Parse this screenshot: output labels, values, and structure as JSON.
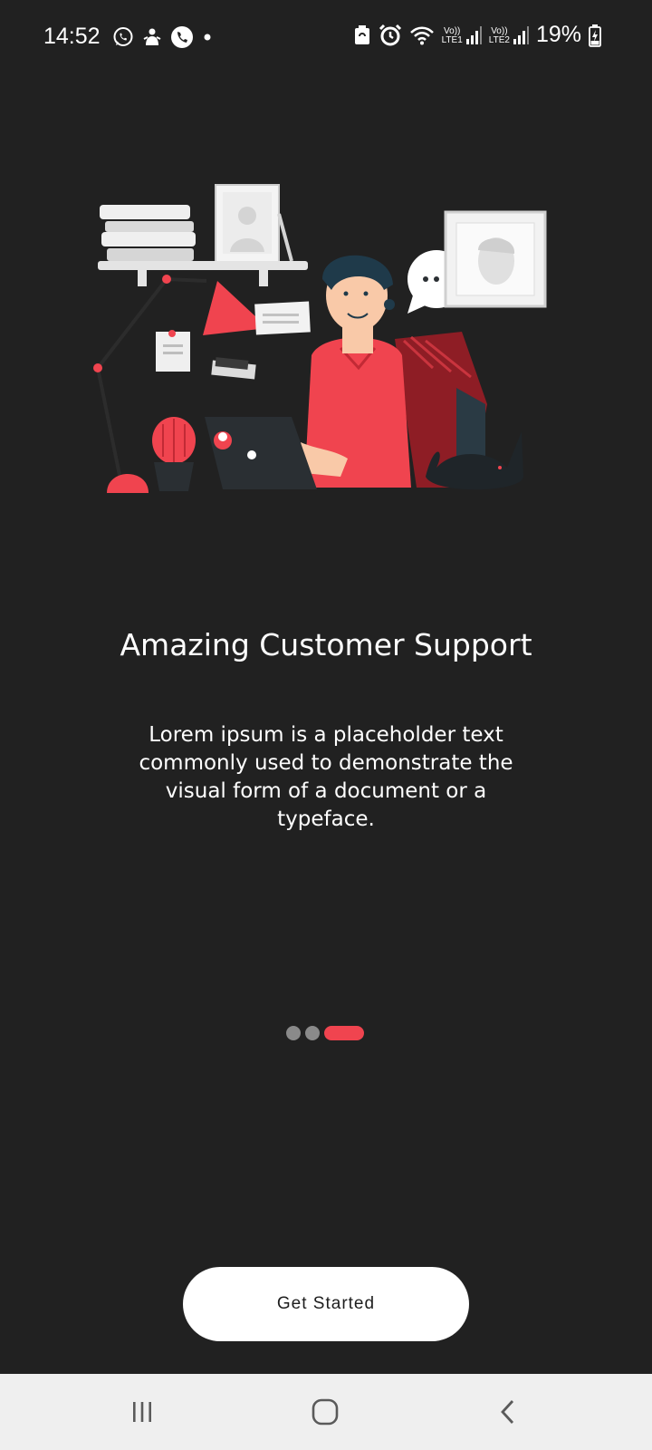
{
  "status_bar": {
    "time": "14:52",
    "left_icons": [
      "whatsapp-icon",
      "notification-icon",
      "phone-call-icon",
      "dot-icon"
    ],
    "right_icons": [
      "battery-saver-icon",
      "alarm-icon",
      "wifi-icon",
      "signal-lte1-icon",
      "signal-lte2-icon"
    ],
    "sim1_label_top": "Vo))",
    "sim1_label_bottom": "LTE1",
    "sim2_label_top": "Vo))",
    "sim2_label_bottom": "LTE2",
    "battery": "19%"
  },
  "onboarding": {
    "illustration": "customer-support-illustration",
    "title": "Amazing Customer Support",
    "description": "Lorem ipsum is a placeholder text commonly used to demonstrate the visual form of a document or a typeface.",
    "page_count": 3,
    "active_page": 3,
    "accent_color": "#f0444f",
    "cta_label": "Get Started"
  },
  "nav_bar": {
    "buttons": [
      "recent-apps-icon",
      "home-icon",
      "back-icon"
    ]
  }
}
